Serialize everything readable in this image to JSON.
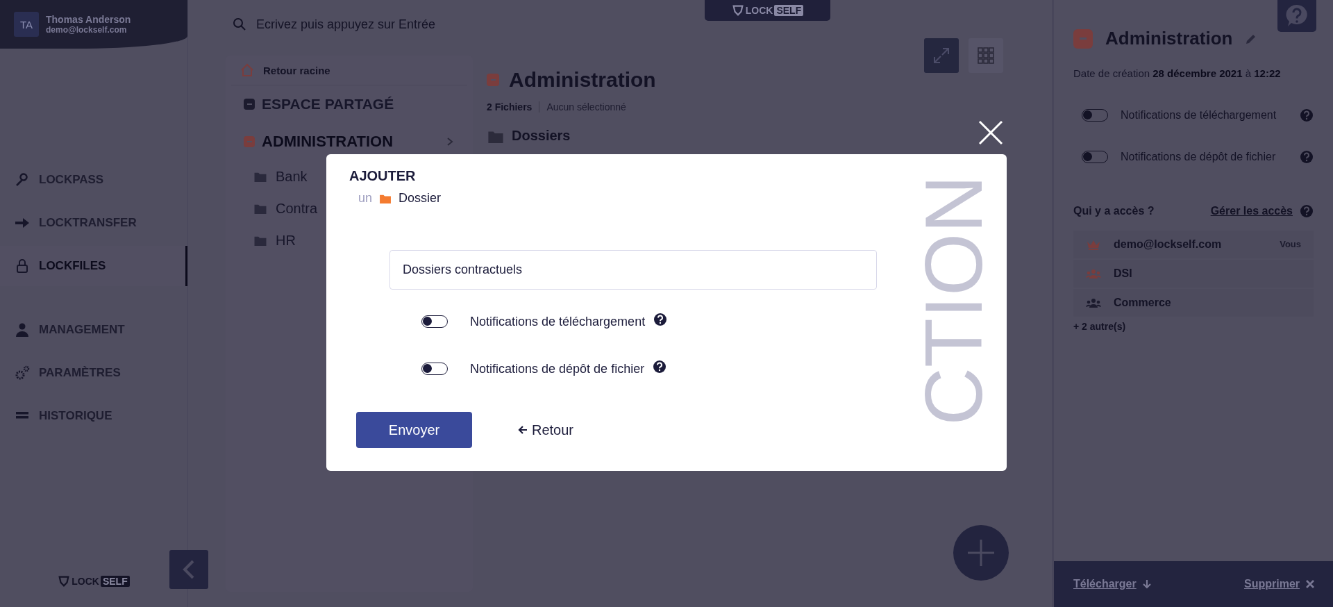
{
  "user": {
    "initials": "TA",
    "name": "Thomas Anderson",
    "email": "demo@lockself.com"
  },
  "nav_groups": [
    [
      {
        "label": "LOCKPASS",
        "kind": "key",
        "selected": false
      },
      {
        "label": "LOCKTRANSFER",
        "kind": "arrow",
        "selected": false
      },
      {
        "label": "LOCKFILES",
        "kind": "lock",
        "selected": true
      }
    ],
    [
      {
        "label": "MANAGEMENT",
        "kind": "user",
        "selected": false
      },
      {
        "label": "PARAMÈTRES",
        "kind": "gears",
        "selected": false
      },
      {
        "label": "HISTORIQUE",
        "kind": "bars",
        "selected": false
      }
    ]
  ],
  "sidebar_logo": {
    "lock": "LOCK",
    "self": "SELF"
  },
  "search": {
    "placeholder": "Ecrivez puis appuyez sur Entrée"
  },
  "top_logo": {
    "lock": "LOCK",
    "self": "SELF"
  },
  "tree": {
    "back": "Retour racine",
    "items": [
      {
        "label": "ESPACE PARTAGÉ",
        "selected": false
      },
      {
        "label": "ADMINISTRATION",
        "selected": true,
        "children": [
          {
            "label": "Bank"
          },
          {
            "label": "Contra"
          },
          {
            "label": "HR"
          }
        ]
      }
    ]
  },
  "main": {
    "title": "Administration",
    "count": "2 Fichiers",
    "selection": "Aucun sélectionné",
    "section": "Dossiers"
  },
  "modal": {
    "title": "AJOUTER",
    "prefix": "un",
    "type": "Dossier",
    "value": "Dossiers contractuels",
    "toggles": [
      {
        "label": "Notifications de téléchargement",
        "on": false
      },
      {
        "label": "Notifications de dépôt de fichier",
        "on": false
      }
    ],
    "submit": "Envoyer",
    "back": "Retour",
    "backdrop_text": "CTION"
  },
  "details": {
    "title": "Administration",
    "created": "Date de création  **28 décembre 2021** à **12:22**",
    "toggles": [
      {
        "label": "Notifications de téléchargement",
        "on": false
      },
      {
        "label": "Notifications de dépôt de fichier",
        "on": false
      }
    ],
    "access_title": "Qui y a accès ?",
    "manage": "Gérer les accès",
    "members": [
      {
        "name": "demo@lockself.com",
        "kind": "owner",
        "color": "#7a3d3d",
        "tag": "Vous"
      },
      {
        "name": "DSI",
        "kind": "group",
        "color": "#7a3d3d"
      },
      {
        "name": "Commerce",
        "kind": "group",
        "color": "#1c1b2e"
      }
    ],
    "more": "+ 2 autre(s)"
  },
  "actions": [
    {
      "label": "Télécharger",
      "kind": "download"
    },
    {
      "label": "Supprimer",
      "kind": "delete"
    }
  ]
}
